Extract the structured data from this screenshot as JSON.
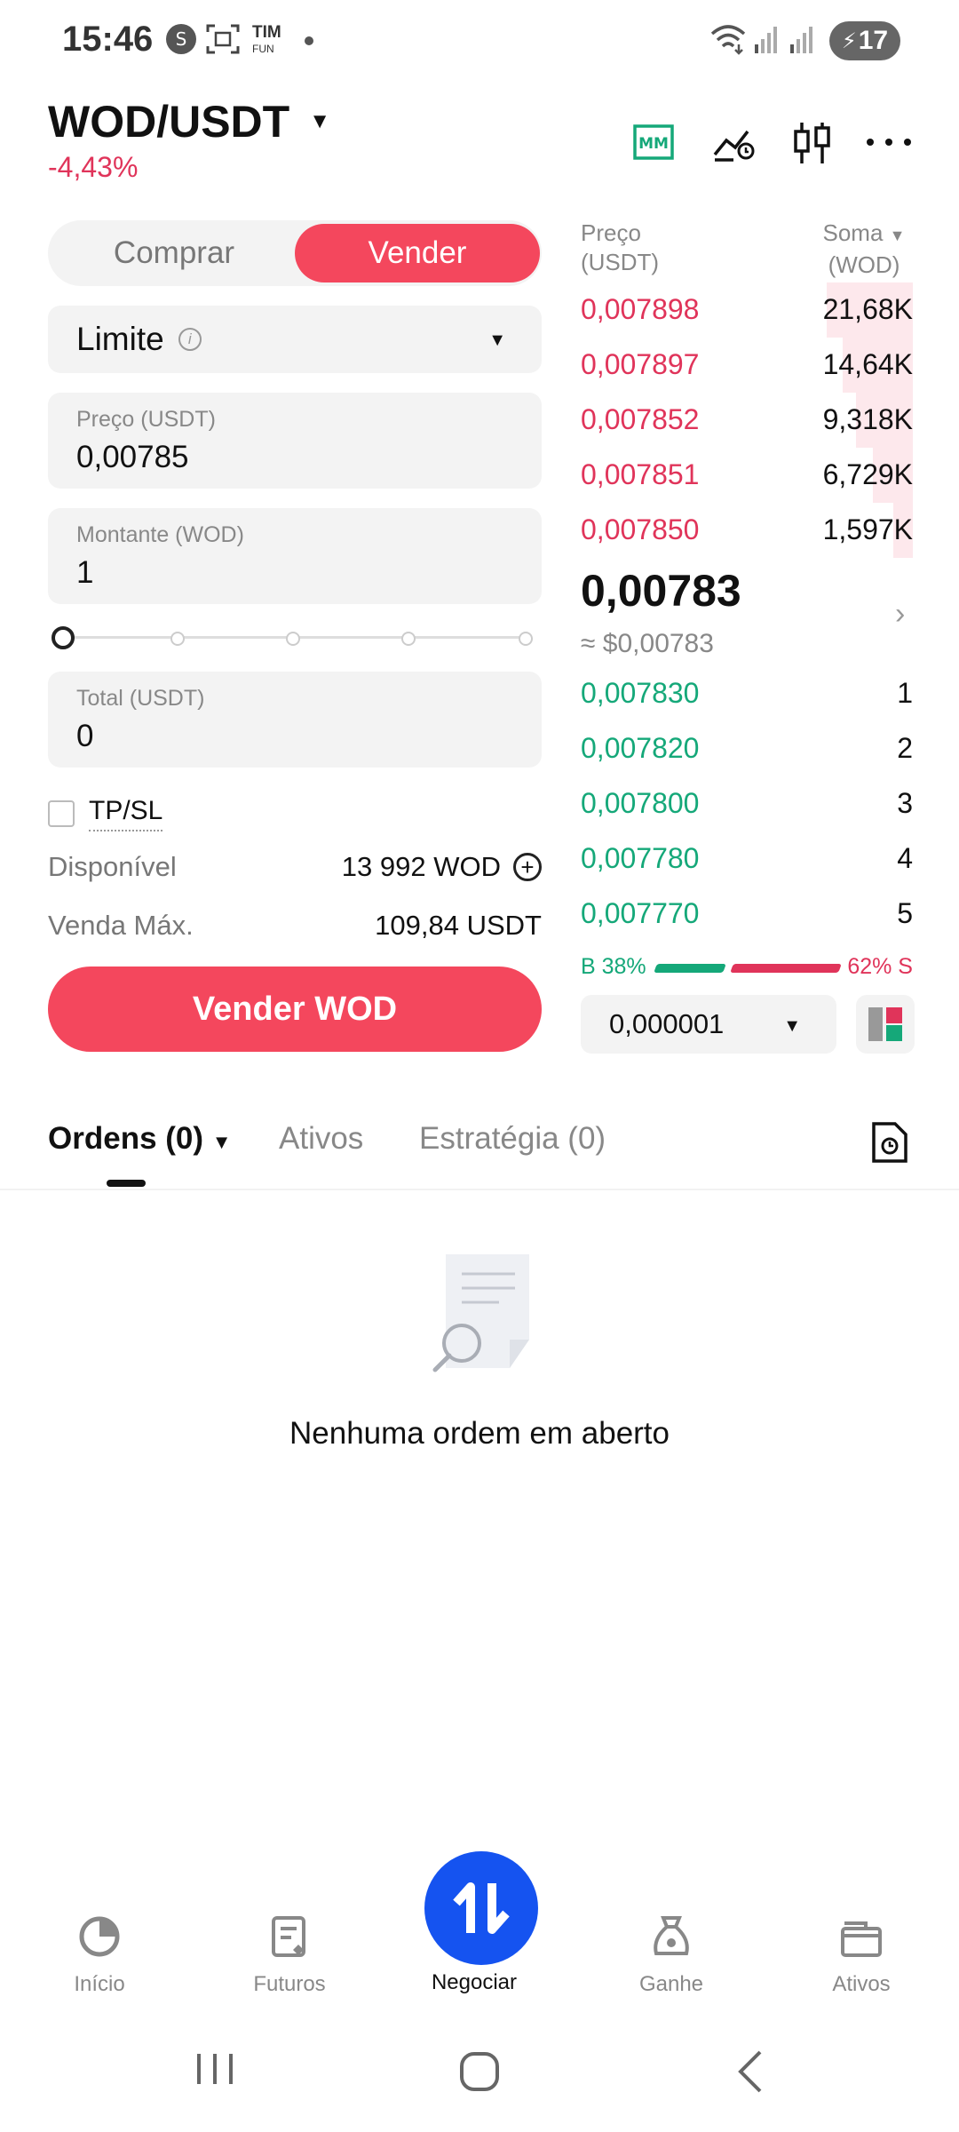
{
  "status_bar": {
    "time": "15:46",
    "carrier": "TIM",
    "carrier_sub": "FUN",
    "battery": "17"
  },
  "header": {
    "pair": "WOD/USDT",
    "change": "-4,43%",
    "icons": [
      "mm-icon",
      "price-alert-icon",
      "candlestick-chart-icon",
      "more-icon"
    ],
    "mm_label": "MM"
  },
  "trade_form": {
    "buy_label": "Comprar",
    "sell_label": "Vender",
    "order_type": "Limite",
    "price_label": "Preço (USDT)",
    "price_value": "0,00785",
    "amount_label": "Montante (WOD)",
    "amount_value": "1",
    "slider_percent": 0,
    "total_label": "Total (USDT)",
    "total_value": "0",
    "tpsl_label": "TP/SL",
    "available_label": "Disponível",
    "available_value": "13 992 WOD",
    "max_sell_label": "Venda Máx.",
    "max_sell_value": "109,84 USDT",
    "submit_label": "Vender WOD"
  },
  "order_book": {
    "price_header": "Preço",
    "price_unit": "(USDT)",
    "sum_header": "Soma",
    "sum_unit": "(WOD)",
    "asks": [
      {
        "price": "0,007898",
        "sum": "21,68K",
        "depth": 0.26
      },
      {
        "price": "0,007897",
        "sum": "14,64K",
        "depth": 0.21
      },
      {
        "price": "0,007852",
        "sum": "9,318K",
        "depth": 0.17
      },
      {
        "price": "0,007851",
        "sum": "6,729K",
        "depth": 0.12
      },
      {
        "price": "0,007850",
        "sum": "1,597K",
        "depth": 0.06
      }
    ],
    "last_price": "0,00783",
    "last_price_usd": "≈ $0,00783",
    "bids": [
      {
        "price": "0,007830",
        "sum": "1"
      },
      {
        "price": "0,007820",
        "sum": "2"
      },
      {
        "price": "0,007800",
        "sum": "3"
      },
      {
        "price": "0,007780",
        "sum": "4"
      },
      {
        "price": "0,007770",
        "sum": "5"
      }
    ],
    "buy_ratio": "B 38%",
    "sell_ratio": "62% S",
    "precision": "0,000001"
  },
  "tabs": {
    "orders": "Ordens (0)",
    "assets": "Ativos",
    "strategy": "Estratégia (0)"
  },
  "empty_state": {
    "text": "Nenhuma ordem em aberto"
  },
  "bottom_nav": {
    "home": "Início",
    "futures": "Futuros",
    "trade": "Negociar",
    "earn": "Ganhe",
    "assets": "Ativos"
  },
  "colors": {
    "sell": "#f4475d",
    "ask_text": "#e0345a",
    "bid_text": "#15a879",
    "accent_blue": "#1553f0"
  }
}
